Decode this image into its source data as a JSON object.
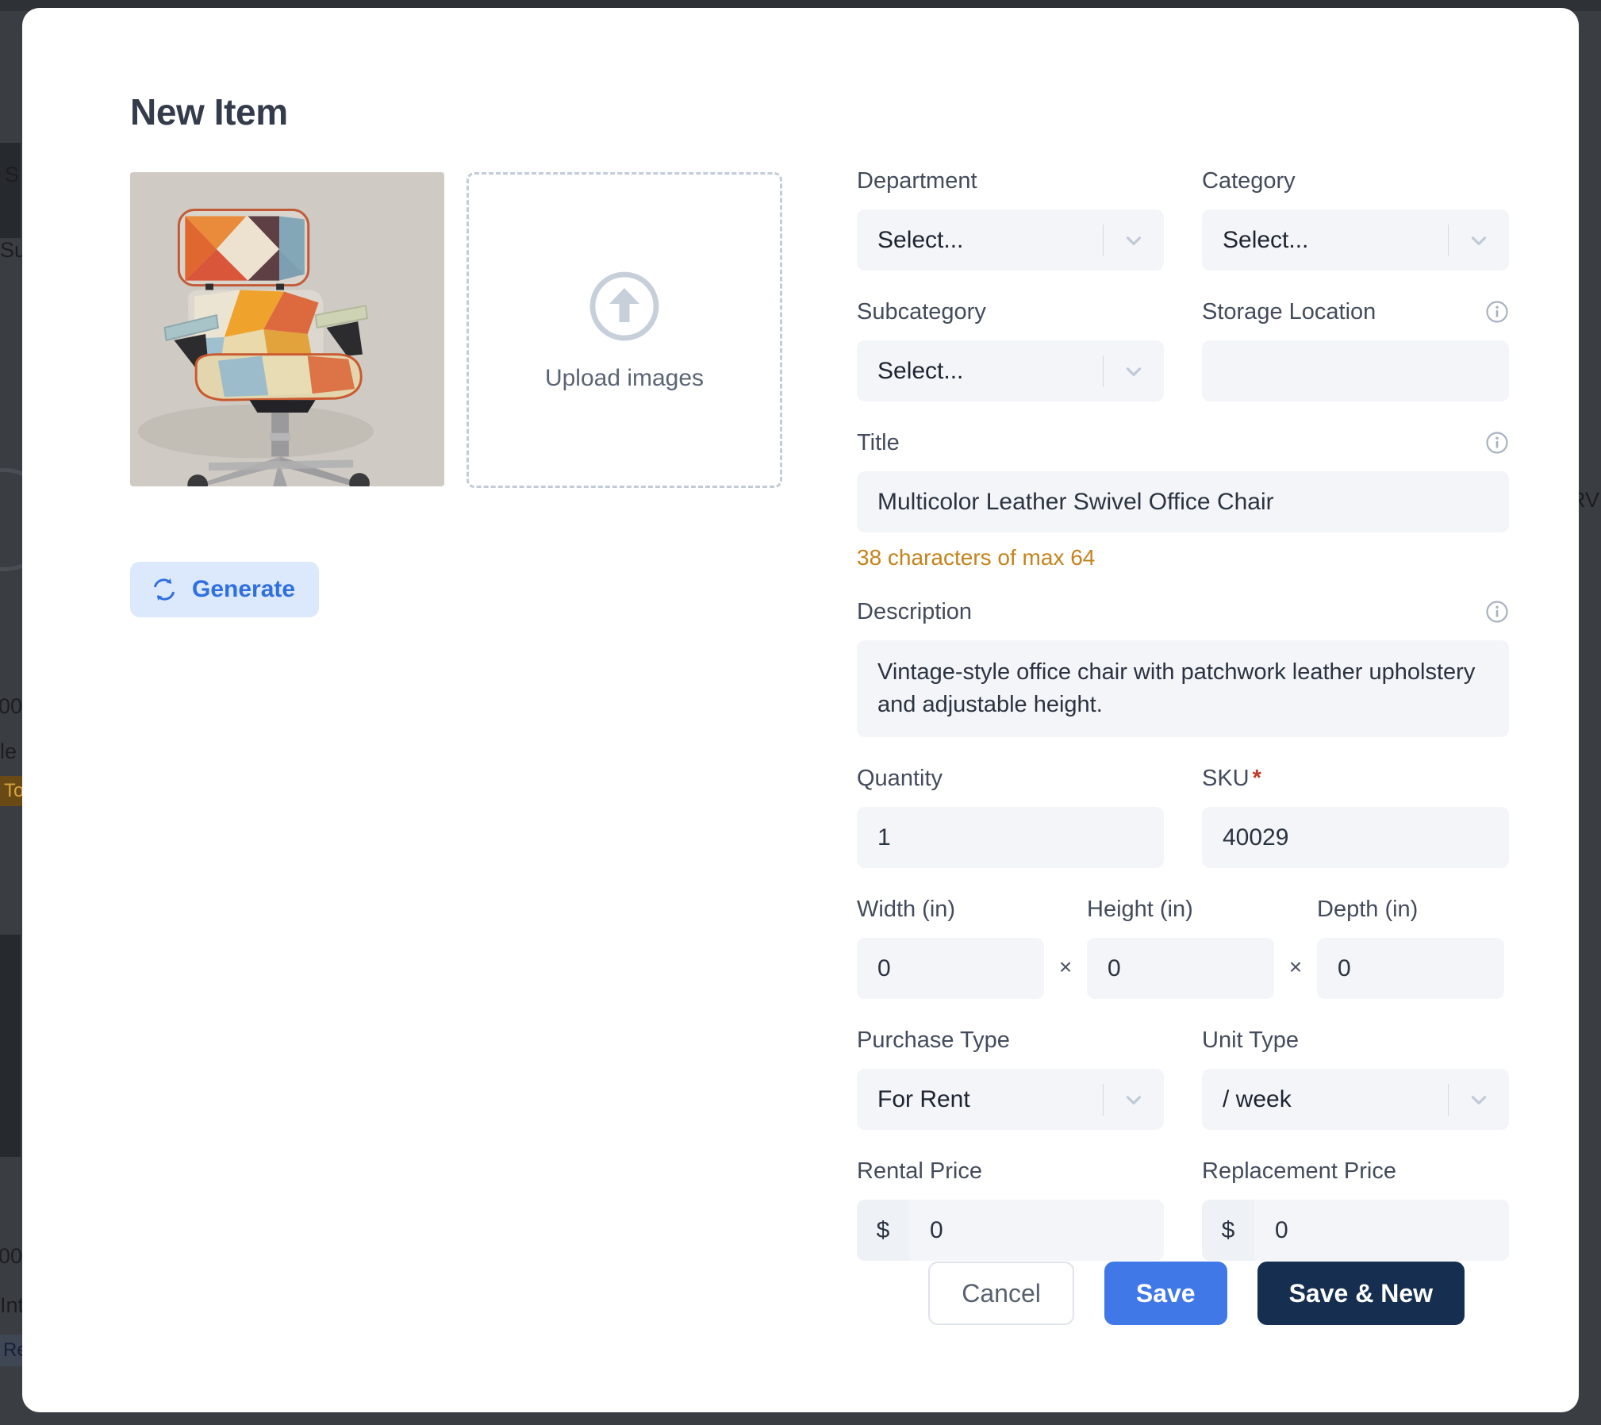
{
  "modal": {
    "title": "New Item"
  },
  "media": {
    "thumbnail_alt": "Multicolor patchwork leather swivel office chair",
    "dropzone_label": "Upload images",
    "upload_icon": "upload-arrow-circle-icon",
    "generate_label": "Generate",
    "generate_icon": "refresh-sync-icon"
  },
  "form": {
    "department": {
      "label": "Department",
      "value": "Select...",
      "icon": "chevron-down-icon"
    },
    "category": {
      "label": "Category",
      "value": "Select...",
      "icon": "chevron-down-icon"
    },
    "subcategory": {
      "label": "Subcategory",
      "value": "Select...",
      "icon": "chevron-down-icon"
    },
    "storage_location": {
      "label": "Storage Location",
      "value": "",
      "placeholder": "",
      "info_icon": "info-circle-icon"
    },
    "title": {
      "label": "Title",
      "value": "Multicolor Leather Swivel Office Chair",
      "info_icon": "info-circle-icon",
      "char_count": "38 characters of max 64",
      "char_count_color": "#c4831b"
    },
    "description": {
      "label": "Description",
      "value": "Vintage-style office chair with patchwork leather upholstery and adjustable height.",
      "info_icon": "info-circle-icon"
    },
    "quantity": {
      "label": "Quantity",
      "value": "1"
    },
    "sku": {
      "label": "SKU",
      "required_marker": "*",
      "required_color": "#c0392b",
      "value": "40029"
    },
    "width": {
      "label": "Width (in)",
      "value": "0"
    },
    "height": {
      "label": "Height (in)",
      "value": "0"
    },
    "depth": {
      "label": "Depth (in)",
      "value": "0"
    },
    "dimension_separator": "×",
    "purchase_type": {
      "label": "Purchase Type",
      "value": "For Rent",
      "icon": "chevron-down-icon"
    },
    "unit_type": {
      "label": "Unit Type",
      "value": "/ week",
      "icon": "chevron-down-icon"
    },
    "rental_price": {
      "label": "Rental Price",
      "currency": "$",
      "value": "0"
    },
    "replacement_price": {
      "label": "Replacement Price",
      "currency": "$",
      "value": "0"
    }
  },
  "footer": {
    "cancel_label": "Cancel",
    "save_label": "Save",
    "save_new_label": "Save & New",
    "save_color": "#4178e8",
    "save_new_color": "#162f50"
  },
  "background": {
    "fragment_s": "S",
    "fragment_sub": "Sub",
    "fragment_zero_top": "00",
    "fragment_le": "le",
    "fragment_to": "To",
    "fragment_zero_bottom": "00",
    "fragment_int": "Int",
    "fragment_re": "Re",
    "fragment_rv": "RV"
  }
}
